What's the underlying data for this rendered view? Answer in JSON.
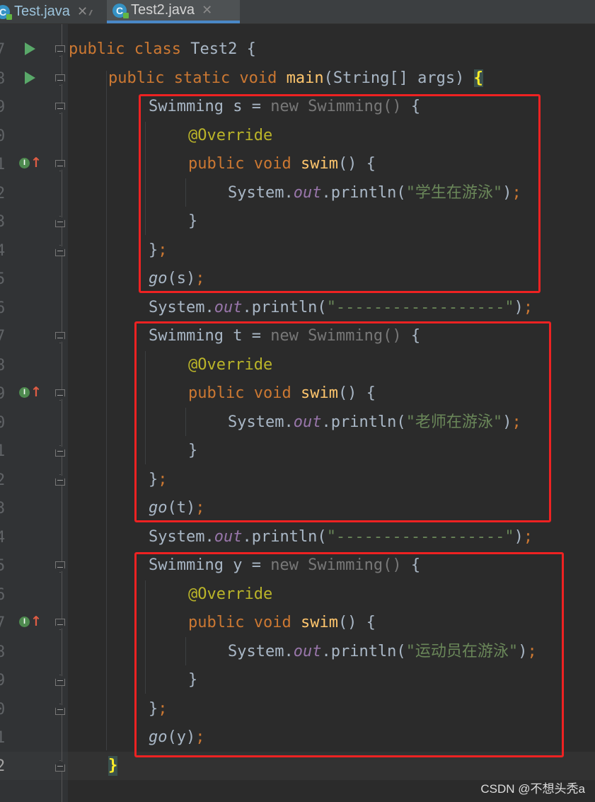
{
  "tabs": [
    {
      "label": "Test.java",
      "icon": "java-class-icon"
    },
    {
      "label": "Test2.java",
      "icon": "java-class-icon",
      "active": true
    }
  ],
  "gutter": {
    "partial_top": "*/",
    "line_numbers": [
      "7",
      "8",
      "9",
      "0",
      "1",
      "2",
      "3",
      "4",
      "5",
      "6",
      "7",
      "8",
      "9",
      "0",
      "1",
      "2",
      "3",
      "4",
      "5",
      "6",
      "7",
      "8",
      "9",
      "0",
      "1",
      "2"
    ],
    "implements_marker": "I"
  },
  "code": {
    "l07": {
      "kw": "public class",
      "name": " Test2 {"
    },
    "l08": {
      "kw": "public static void",
      "fn": "main",
      "rest": "(String[] args) ",
      "brace": "{"
    },
    "block1": {
      "decl": "Swimming s = ",
      "new_kw": "new Swimming()",
      "open": " {",
      "override": "@Override",
      "method_kw": "public void",
      "method": "swim",
      "method_rest": "() {",
      "sys": "System.",
      "out": "out",
      "println": ".println(",
      "text": "\"学生在游泳\"",
      "end": ")",
      "close_brace": "}",
      "close_obj": "}",
      "go": "go",
      "go_arg": "(s)"
    },
    "sep1": {
      "sys": "System.",
      "out": "out",
      "println": ".println(",
      "text": "\"------------------\"",
      "end": ")"
    },
    "block2": {
      "decl": "Swimming t = ",
      "new_kw": "new Swimming()",
      "open": " {",
      "override": "@Override",
      "method_kw": "public void",
      "method": "swim",
      "method_rest": "() {",
      "sys": "System.",
      "out": "out",
      "println": ".println(",
      "text": "\"老师在游泳\"",
      "end": ")",
      "close_brace": "}",
      "close_obj": "}",
      "go": "go",
      "go_arg": "(t)"
    },
    "sep2": {
      "sys": "System.",
      "out": "out",
      "println": ".println(",
      "text": "\"------------------\"",
      "end": ")"
    },
    "block3": {
      "decl": "Swimming y = ",
      "new_kw": "new Swimming()",
      "open": " {",
      "override": "@Override",
      "method_kw": "public void",
      "method": "swim",
      "method_rest": "() {",
      "sys": "System.",
      "out": "out",
      "println": ".println(",
      "text": "\"运动员在游泳\"",
      "end": ")",
      "close_brace": "}",
      "close_obj": "}",
      "go": "go",
      "go_arg": "(y)"
    },
    "l32": "}",
    "semi": ";"
  },
  "watermark": "CSDN @不想头秃a",
  "colors": {
    "editor_bg": "#2b2b2b",
    "keyword": "#cc7832",
    "function": "#ffc66d",
    "annotation": "#bbb529",
    "string": "#6a8759",
    "static_field": "#9876aa",
    "highlight_box": "#ee2222"
  }
}
